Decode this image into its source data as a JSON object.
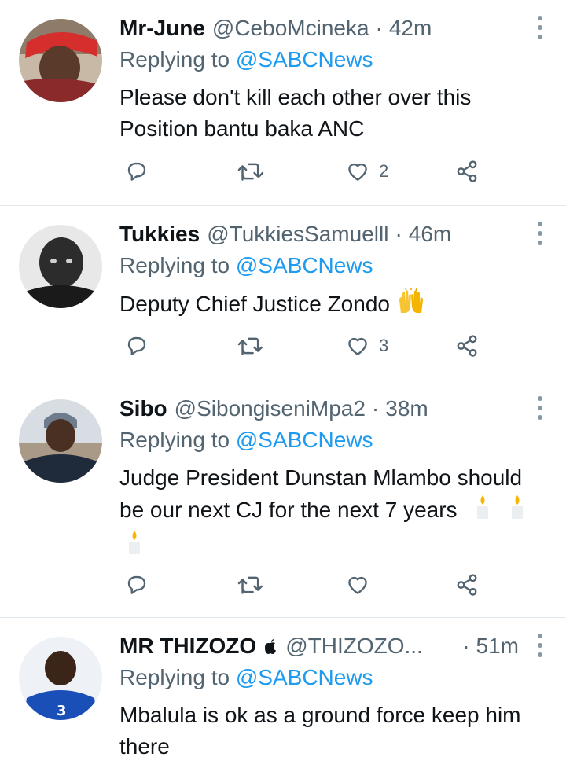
{
  "replying_label": "Replying to",
  "tweets": [
    {
      "name": "Mr-June",
      "handle": "@CeboMcineka",
      "separator": "·",
      "time": "42m",
      "reply_to": "@SABCNews",
      "text_lines": [
        "Please don't kill each other over this",
        "Position bantu baka ANC"
      ],
      "likes": "2",
      "avatar": "avatar-red-cap-photo"
    },
    {
      "name": "Tukkies",
      "handle": "@TukkiesSamuelll",
      "separator": "·",
      "time": "46m",
      "reply_to": "@SABCNews",
      "text_lines": [
        "Deputy Chief Justice Zondo"
      ],
      "emoji": "raising-hands-emoji",
      "likes": "3",
      "avatar": "avatar-grayscale-photo"
    },
    {
      "name": "Sibo",
      "handle": "@SibongiseniMpa2",
      "separator": "·",
      "time": "38m",
      "reply_to": "@SABCNews",
      "text_lines": [
        "Judge President Dunstan Mlambo should",
        "be our next CJ for the next 7 years"
      ],
      "emoji": "candle-emoji",
      "likes": "",
      "avatar": "avatar-beanie-photo"
    },
    {
      "name": "MR THIZOZO",
      "badge": "apple-icon",
      "handle": "@THIZOZO...",
      "separator": "·",
      "time": "51m",
      "reply_to": "@SABCNews",
      "text_lines": [
        "Mbalula is ok as a ground force keep him",
        "there"
      ],
      "avatar": "avatar-blue-jersey-photo"
    }
  ],
  "colors": {
    "text": "#0f1419",
    "secondary": "#536471",
    "link": "#1d9bf0",
    "divider": "#e1e8ed"
  }
}
